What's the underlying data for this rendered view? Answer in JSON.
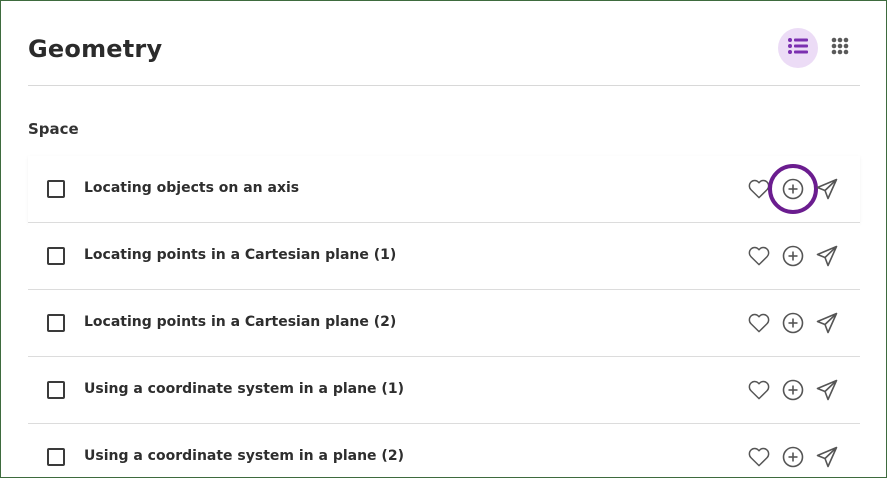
{
  "header": {
    "title": "Geometry",
    "view_toggle": {
      "active": "list",
      "list_icon": "list-view-icon",
      "grid_icon": "grid-view-icon"
    }
  },
  "section": {
    "title": "Space"
  },
  "rows": [
    {
      "label": "Locating objects on an axis",
      "checked": false,
      "highlighted_action": "add"
    },
    {
      "label": "Locating points in a Cartesian plane (1)",
      "checked": false
    },
    {
      "label": "Locating points in a Cartesian plane (2)",
      "checked": false
    },
    {
      "label": "Using a coordinate system in a plane (1)",
      "checked": false
    },
    {
      "label": "Using a coordinate system in a plane (2)",
      "checked": false
    }
  ],
  "row_actions": [
    "heart-icon",
    "add-circle-icon",
    "send-icon"
  ],
  "colors": {
    "accent": "#7b2fb0",
    "accent_light": "#ecdcf6",
    "highlight_ring": "#6b1d8f",
    "icon": "#555555",
    "divider": "#dcdcdc",
    "frame_border": "#3e6b3e"
  }
}
